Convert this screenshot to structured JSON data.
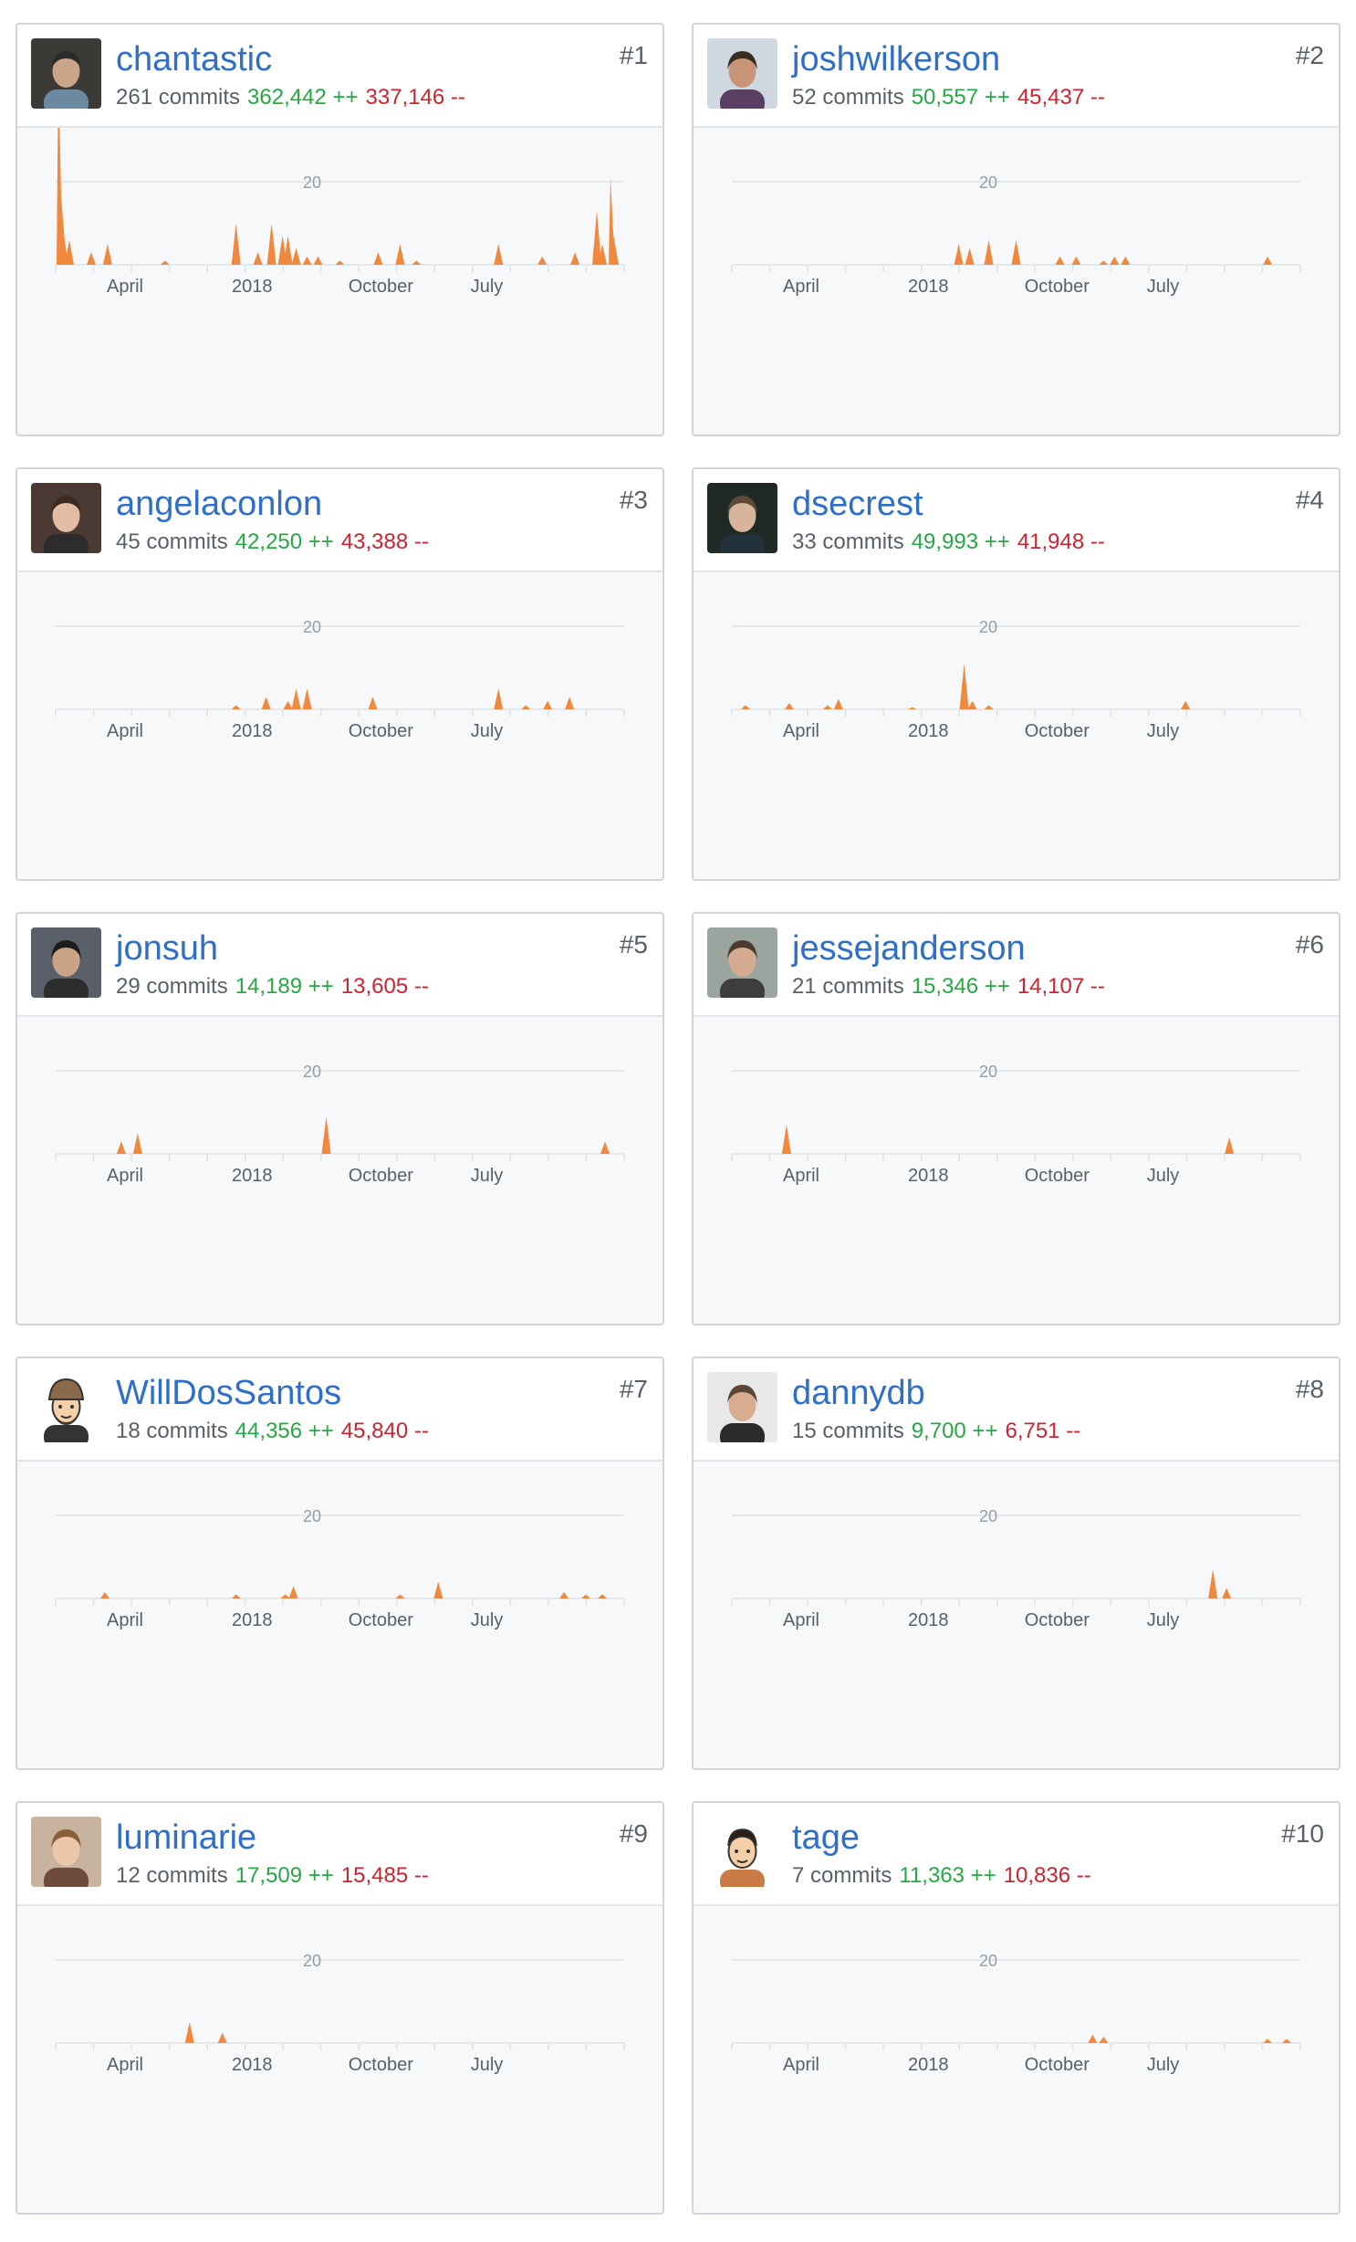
{
  "chart_common": {
    "type": "area",
    "ylim": [
      0,
      50
    ],
    "y_ticks": [
      20,
      40
    ],
    "x_tick_labels": [
      "April",
      "2018",
      "October",
      "July"
    ],
    "fill_color": "#f0883e",
    "grid": true
  },
  "contributors": [
    {
      "username": "chantastic",
      "commits": "261 commits",
      "additions": "362,442 ++",
      "deletions": "337,146 --",
      "rank": "#1",
      "avatar": "avatar-photo",
      "chart_data": {
        "type": "area",
        "series": [
          {
            "x": 0.5,
            "y": 47
          },
          {
            "x": 1.5,
            "y": 7
          },
          {
            "x": 2.5,
            "y": 6
          },
          {
            "x": 6.5,
            "y": 3
          },
          {
            "x": 9.5,
            "y": 5
          },
          {
            "x": 20,
            "y": 1
          },
          {
            "x": 33,
            "y": 10
          },
          {
            "x": 37,
            "y": 3
          },
          {
            "x": 39.5,
            "y": 10
          },
          {
            "x": 41.5,
            "y": 7
          },
          {
            "x": 42.5,
            "y": 7
          },
          {
            "x": 44,
            "y": 4
          },
          {
            "x": 46,
            "y": 2
          },
          {
            "x": 48,
            "y": 2
          },
          {
            "x": 52,
            "y": 1
          },
          {
            "x": 59,
            "y": 3
          },
          {
            "x": 63,
            "y": 5
          },
          {
            "x": 66,
            "y": 1
          },
          {
            "x": 81,
            "y": 5
          },
          {
            "x": 89,
            "y": 2
          },
          {
            "x": 95,
            "y": 3
          },
          {
            "x": 99,
            "y": 13
          },
          {
            "x": 100,
            "y": 5
          },
          {
            "x": 101.5,
            "y": 21
          }
        ]
      }
    },
    {
      "username": "joshwilkerson",
      "commits": "52 commits",
      "additions": "50,557 ++",
      "deletions": "45,437 --",
      "rank": "#2",
      "avatar": "avatar-photo",
      "chart_data": {
        "type": "area",
        "series": [
          {
            "x": 41.5,
            "y": 5
          },
          {
            "x": 43.5,
            "y": 4
          },
          {
            "x": 47,
            "y": 6
          },
          {
            "x": 52,
            "y": 6
          },
          {
            "x": 60,
            "y": 2
          },
          {
            "x": 63,
            "y": 2
          },
          {
            "x": 68,
            "y": 1
          },
          {
            "x": 70,
            "y": 2
          },
          {
            "x": 72,
            "y": 2
          },
          {
            "x": 98,
            "y": 2
          }
        ]
      }
    },
    {
      "username": "angelaconlon",
      "commits": "45 commits",
      "additions": "42,250 ++",
      "deletions": "43,388 --",
      "rank": "#3",
      "avatar": "avatar-photo",
      "chart_data": {
        "type": "area",
        "series": [
          {
            "x": 33,
            "y": 1
          },
          {
            "x": 38.5,
            "y": 3
          },
          {
            "x": 42.5,
            "y": 2
          },
          {
            "x": 44,
            "y": 5
          },
          {
            "x": 46,
            "y": 5
          },
          {
            "x": 58,
            "y": 3
          },
          {
            "x": 81,
            "y": 5
          },
          {
            "x": 86,
            "y": 1
          },
          {
            "x": 90,
            "y": 2
          },
          {
            "x": 94,
            "y": 3
          }
        ]
      }
    },
    {
      "username": "dsecrest",
      "commits": "33 commits",
      "additions": "49,993 ++",
      "deletions": "41,948 --",
      "rank": "#4",
      "avatar": "avatar-photo",
      "chart_data": {
        "type": "area",
        "series": [
          {
            "x": 2.5,
            "y": 1
          },
          {
            "x": 10.5,
            "y": 1.5
          },
          {
            "x": 17.5,
            "y": 1
          },
          {
            "x": 19.5,
            "y": 2.5
          },
          {
            "x": 33,
            "y": 0.5
          },
          {
            "x": 42.5,
            "y": 11
          },
          {
            "x": 44,
            "y": 2
          },
          {
            "x": 47,
            "y": 1
          },
          {
            "x": 83,
            "y": 2
          }
        ]
      }
    },
    {
      "username": "jonsuh",
      "commits": "29 commits",
      "additions": "14,189 ++",
      "deletions": "13,605 --",
      "rank": "#5",
      "avatar": "avatar-photo",
      "chart_data": {
        "type": "area",
        "series": [
          {
            "x": 12,
            "y": 3
          },
          {
            "x": 15,
            "y": 5
          },
          {
            "x": 49.5,
            "y": 9
          },
          {
            "x": 100.5,
            "y": 3
          }
        ]
      }
    },
    {
      "username": "jessejanderson",
      "commits": "21 commits",
      "additions": "15,346 ++",
      "deletions": "14,107 --",
      "rank": "#6",
      "avatar": "avatar-photo",
      "chart_data": {
        "type": "area",
        "series": [
          {
            "x": 10,
            "y": 7
          },
          {
            "x": 91,
            "y": 4
          }
        ]
      }
    },
    {
      "username": "WillDosSantos",
      "commits": "18 commits",
      "additions": "44,356 ++",
      "deletions": "45,840 --",
      "rank": "#7",
      "avatar": "avatar-cartoon",
      "chart_data": {
        "type": "area",
        "series": [
          {
            "x": 9,
            "y": 1.5
          },
          {
            "x": 33,
            "y": 1
          },
          {
            "x": 42,
            "y": 1
          },
          {
            "x": 43.5,
            "y": 3
          },
          {
            "x": 63,
            "y": 1
          },
          {
            "x": 70,
            "y": 4
          },
          {
            "x": 93,
            "y": 1.5
          },
          {
            "x": 97,
            "y": 1
          },
          {
            "x": 100,
            "y": 1
          }
        ]
      }
    },
    {
      "username": "dannydb",
      "commits": "15 commits",
      "additions": "9,700 ++",
      "deletions": "6,751 --",
      "rank": "#8",
      "avatar": "avatar-photo",
      "chart_data": {
        "type": "area",
        "series": [
          {
            "x": 88,
            "y": 7
          },
          {
            "x": 90.5,
            "y": 2.5
          }
        ]
      }
    },
    {
      "username": "luminarie",
      "commits": "12 commits",
      "additions": "17,509 ++",
      "deletions": "15,485 --",
      "rank": "#9",
      "avatar": "avatar-photo",
      "chart_data": {
        "type": "area",
        "series": [
          {
            "x": 24.5,
            "y": 5
          },
          {
            "x": 30.5,
            "y": 2.5
          }
        ]
      }
    },
    {
      "username": "tage",
      "commits": "7 commits",
      "additions": "11,363 ++",
      "deletions": "10,836 --",
      "rank": "#10",
      "avatar": "avatar-cartoon",
      "chart_data": {
        "type": "area",
        "series": [
          {
            "x": 66,
            "y": 2
          },
          {
            "x": 68,
            "y": 1.5
          },
          {
            "x": 98,
            "y": 1
          },
          {
            "x": 101.5,
            "y": 1
          }
        ]
      }
    }
  ],
  "colors": {
    "username": "#2f6fc9",
    "additions": "#28a745",
    "deletions": "#cb2431",
    "area": "#f0883e",
    "gridline": "#dfe2e5"
  }
}
